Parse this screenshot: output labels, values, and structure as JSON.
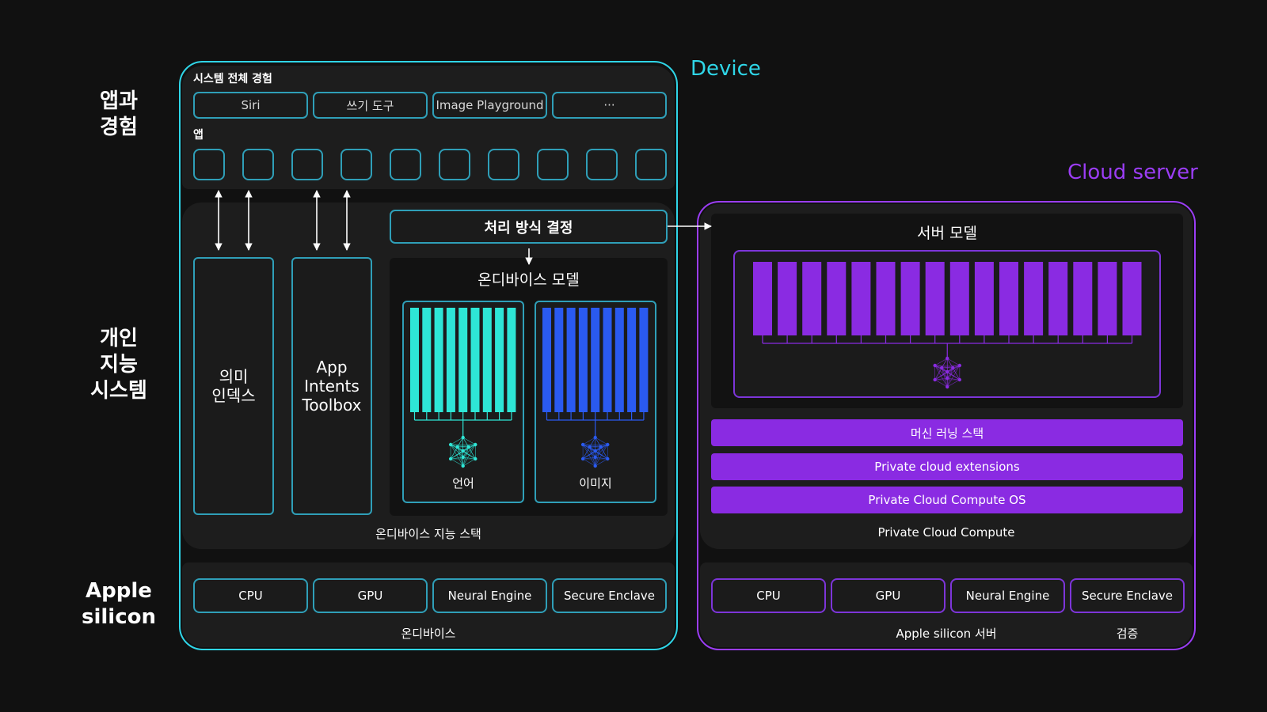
{
  "row_labels": {
    "app_experience": [
      "앱과",
      "경험"
    ],
    "personal_intelligence": [
      "개인",
      "지능",
      "시스템"
    ],
    "apple_silicon": [
      "Apple",
      "silicon"
    ]
  },
  "device": {
    "title": "Device",
    "title_color": "#2fd6e8",
    "systemwide_heading": "시스템 전체 경험",
    "systemwide_items": [
      "Siri",
      "쓰기 도구",
      "Image Playground",
      "···"
    ],
    "apps_heading": "앱",
    "app_count": 10,
    "semantic_index": [
      "의미",
      "인덱스"
    ],
    "app_intents": [
      "App",
      "Intents",
      "Toolbox"
    ],
    "orchestration": "처리 방식 결정",
    "ondevice_models_title": "온디바이스 모델",
    "language_model_label": "언어",
    "language_color": "#2ee6d6",
    "image_model_label": "이미지",
    "image_color": "#2a5af0",
    "stack_caption": "온디바이스 지능 스택",
    "chips": [
      "CPU",
      "GPU",
      "Neural Engine",
      "Secure Enclave"
    ],
    "silicon_caption": "온디바이스"
  },
  "cloud": {
    "title": "Cloud server",
    "title_color": "#9b3df5",
    "server_model_title": "서버 모델",
    "server_color": "#8a2be2",
    "stack_items": [
      "머신 러닝 스택",
      "Private cloud extensions",
      "Private Cloud Compute OS"
    ],
    "pcc_caption": "Private Cloud Compute",
    "chips": [
      "CPU",
      "GPU",
      "Neural Engine",
      "Secure Enclave"
    ],
    "silicon_caption": "Apple silicon 서버",
    "verify_caption": "검증"
  }
}
